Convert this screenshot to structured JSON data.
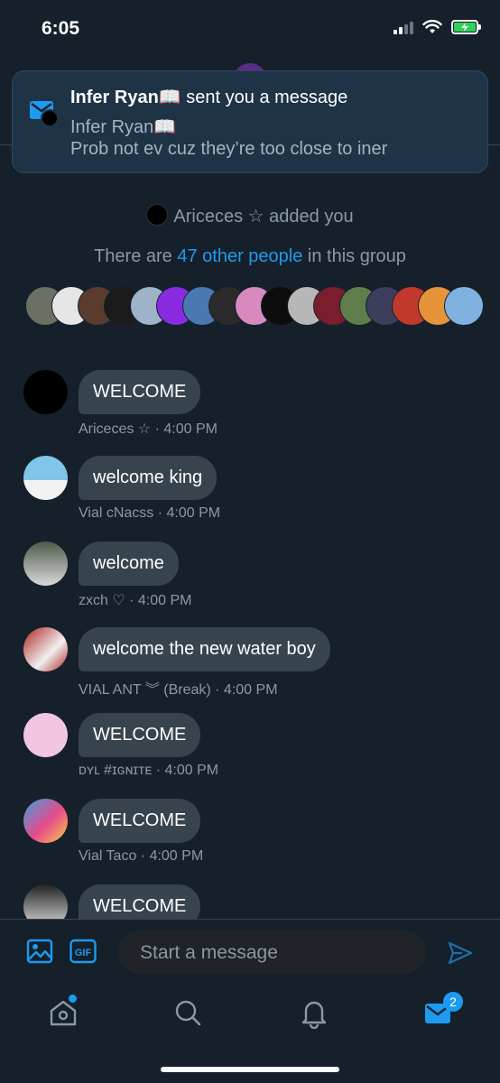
{
  "status": {
    "time": "6:05"
  },
  "notification": {
    "sender": "Infer Ryan📖",
    "action": "sent you a message",
    "line1": "Infer Ryan📖",
    "line2": "Prob not ev cuz they’re too close to iner"
  },
  "system": {
    "added_text": "Ariceces ☆ added you",
    "group_prefix": "There are ",
    "group_link": "47 other people",
    "group_suffix": " in this group"
  },
  "colors": {
    "background": "#15202b",
    "bubble": "#38444d",
    "accent": "#1d9bf0",
    "muted": "#8b98a5"
  },
  "messages": [
    {
      "text": "WELCOME",
      "meta": "Ariceces ☆ · 4:00 PM"
    },
    {
      "text": "welcome king",
      "meta": "Vial cNacss · 4:00 PM"
    },
    {
      "text": "welcome",
      "meta": "zxch ♡ · 4:00 PM"
    },
    {
      "text": "welcome the new water boy",
      "meta": "VIAL ANT ︾ (Break) · 4:00 PM"
    },
    {
      "text": "WELCOME",
      "meta": "ᴅʏʟ #ɪɢɴɪᴛᴇ · 4:00 PM"
    },
    {
      "text": "WELCOME",
      "meta": "Vial Taco · 4:00 PM"
    },
    {
      "text": "WELCOME",
      "meta": ""
    }
  ],
  "composer": {
    "placeholder": "Start a message",
    "icons": [
      "image-icon",
      "gif-icon",
      "send-icon"
    ],
    "gif_label": "GIF"
  },
  "tabbar": {
    "icons": [
      "home-icon",
      "search-icon",
      "notifications-icon",
      "messages-icon"
    ],
    "messages_badge": "2"
  }
}
